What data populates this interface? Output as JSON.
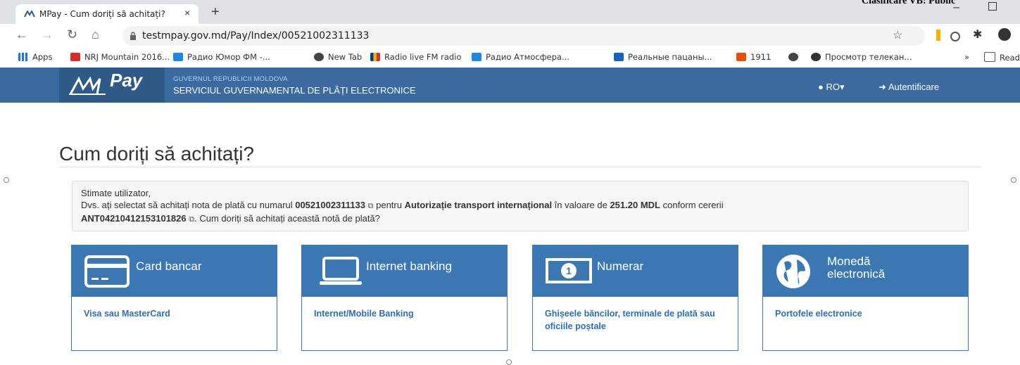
{
  "browser": {
    "tab_title": "MPay - Cum doriți să achitați?",
    "tab_close": "×",
    "new_tab": "+",
    "watermark": "Clasificare VB: Public",
    "url": "testmpay.gov.md/Pay/Index/00521002311133",
    "bookmarks": [
      {
        "label": "Apps",
        "icon": "apps-grid-icon",
        "color": "#1a73e8"
      },
      {
        "label": "NRJ Mountain 2016...",
        "icon": "nrj-icon",
        "color": "#d32f2f"
      },
      {
        "label": "Радио Юмор ФМ -...",
        "icon": "radio-icon",
        "color": "#1e88e5"
      },
      {
        "label": "New Tab",
        "icon": "globe-icon",
        "color": "#444444"
      },
      {
        "label": "Radio live FM radio",
        "icon": "flag-icon",
        "color": "#f4b400"
      },
      {
        "label": "Радио Атмосфера...",
        "icon": "radio-icon",
        "color": "#1e88e5"
      },
      {
        "label": "Реальные пацаны...",
        "icon": "plane-icon",
        "color": "#1565c0"
      },
      {
        "label": "1911",
        "icon": "star-logo-icon",
        "color": "#e65100"
      },
      {
        "label": "",
        "icon": "globe-icon",
        "color": "#444444"
      },
      {
        "label": "Просмотр телекан...",
        "icon": "broadcast-icon",
        "color": "#333333"
      },
      {
        "label": "»",
        "icon": "",
        "color": "#333333"
      },
      {
        "label": "Readi",
        "icon": "reading-list-icon",
        "color": "#555555"
      }
    ]
  },
  "header": {
    "logo": "MPay",
    "gov_line1": "GUVERNUL REPUBLICII MOLDOVA",
    "gov_line2": "SERVICIUL GUVERNAMENTAL DE PLĂȚI ELECTRONICE",
    "language": "RO▾",
    "login": "Autentificare",
    "color": "#3a6a9f"
  },
  "main": {
    "title": "Cum doriți să achitați?",
    "alert": {
      "greeting": "Stimate utilizator,",
      "t1": "Dvs. ați selectat să achitați nota de plată cu numarul ",
      "invoice": "00521002311133",
      "t2": " pentru ",
      "service": "Autorizație transport internațional",
      "t3": " în valoare de ",
      "amount": "251.20 MDL",
      "t4": " conform cererii",
      "request": "ANT04210412153101826",
      "t5": ". Cum doriți să achitați această notă de plată?"
    },
    "methods": [
      {
        "title": "Card bancar",
        "link": "Visa sau MasterCard",
        "icon": "credit-card-icon"
      },
      {
        "title": "Internet banking",
        "link": "Internet/Mobile Banking",
        "icon": "laptop-icon"
      },
      {
        "title": "Numerar",
        "link": "Ghișeele băncilor, terminale de plată sau oficiile poștale",
        "icon": "banknote-icon"
      },
      {
        "title": "Monedă electronică",
        "link": "Portofele electronice",
        "icon": "globe-icon"
      }
    ],
    "accent": "#3a77b3"
  }
}
